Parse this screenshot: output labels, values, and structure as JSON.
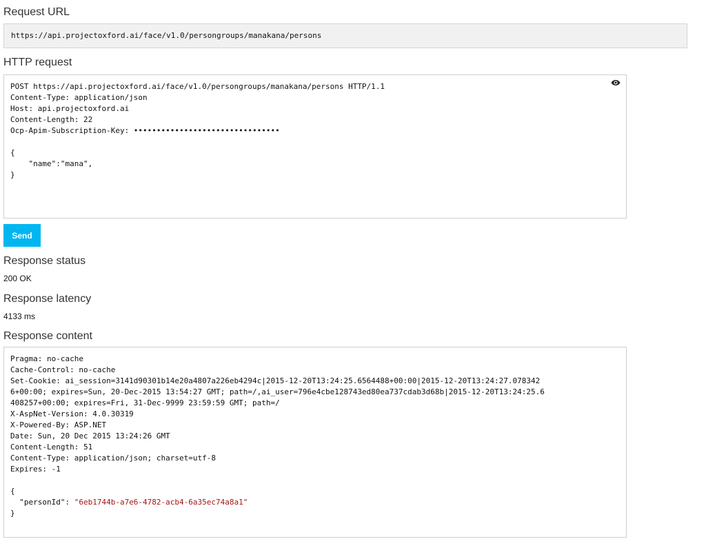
{
  "request_url": {
    "label": "Request URL",
    "value": "https://api.projectoxford.ai/face/v1.0/persongroups/manakana/persons"
  },
  "http_request": {
    "label": "HTTP request",
    "lines": [
      "POST https://api.projectoxford.ai/face/v1.0/persongroups/manakana/persons HTTP/1.1",
      "Content-Type: application/json",
      "Host: api.projectoxford.ai",
      "Content-Length: 22",
      "Ocp-Apim-Subscription-Key: ••••••••••••••••••••••••••••••••",
      "",
      "{",
      "    \"name\":\"mana\",",
      "}"
    ],
    "toggle_icon": "eye-icon"
  },
  "send_button": {
    "label": "Send",
    "color": "#00b6f0"
  },
  "response_status": {
    "label": "Response status",
    "value": "200 OK"
  },
  "response_latency": {
    "label": "Response latency",
    "value": "4133 ms"
  },
  "response_content": {
    "label": "Response content",
    "header_lines": [
      "Pragma: no-cache",
      "Cache-Control: no-cache",
      "Set-Cookie: ai_session=3141d90301b14e20a4807a226eb4294c|2015-12-20T13:24:25.6564488+00:00|2015-12-20T13:24:27.078342",
      "6+00:00; expires=Sun, 20-Dec-2015 13:54:27 GMT; path=/,ai_user=796e4cbe128743ed80ea737cdab3d68b|2015-12-20T13:24:25.6",
      "408257+00:00; expires=Fri, 31-Dec-9999 23:59:59 GMT; path=/",
      "X-AspNet-Version: 4.0.30319",
      "X-Powered-By: ASP.NET",
      "Date: Sun, 20 Dec 2015 13:24:26 GMT",
      "Content-Length: 51",
      "Content-Type: application/json; charset=utf-8",
      "Expires: -1",
      ""
    ],
    "body_open": "{",
    "body_key": "  \"personId\": ",
    "body_value": "\"6eb1744b-a7e6-4782-acb4-6a35ec74a8a1\"",
    "body_close": "}",
    "string_color": "#a31515"
  }
}
